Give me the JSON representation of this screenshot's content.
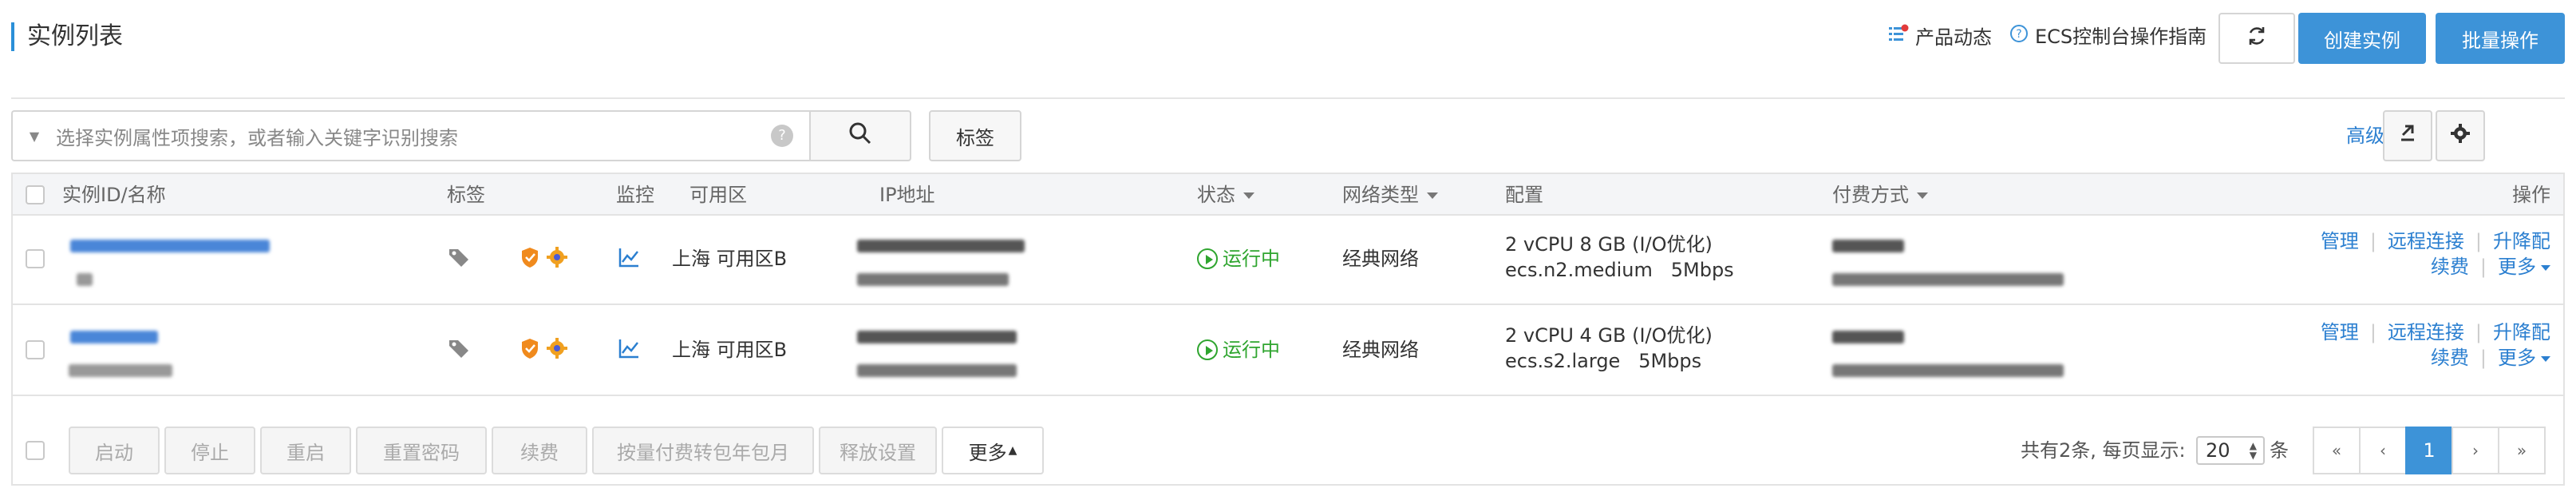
{
  "header": {
    "title": "实例列表",
    "news_label": "产品动态",
    "guide_label": "ECS控制台操作指南",
    "create_label": "创建实例",
    "batch_label": "批量操作"
  },
  "search": {
    "placeholder": "选择实例属性项搜索，或者输入关键字识别搜索",
    "tag_label": "标签",
    "advanced_label": "高级搜索"
  },
  "table": {
    "columns": {
      "id_name": "实例ID/名称",
      "tags": "标签",
      "monitor": "监控",
      "zone": "可用区",
      "ip": "IP地址",
      "status": "状态",
      "network": "网络类型",
      "config": "配置",
      "billing": "付费方式",
      "actions": "操作"
    },
    "rows": [
      {
        "zone": "上海 可用区B",
        "status": "运行中",
        "network": "经典网络",
        "config_line1": "2 vCPU 8 GB (I/O优化)",
        "config_line2": "ecs.n2.medium   5Mbps",
        "actions": {
          "manage": "管理",
          "remote": "远程连接",
          "upgrade": "升降配",
          "renew": "续费",
          "more": "更多"
        }
      },
      {
        "zone": "上海 可用区B",
        "status": "运行中",
        "network": "经典网络",
        "config_line1": "2 vCPU 4 GB (I/O优化)",
        "config_line2": "ecs.s2.large   5Mbps",
        "actions": {
          "manage": "管理",
          "remote": "远程连接",
          "upgrade": "升降配",
          "renew": "续费",
          "more": "更多"
        }
      }
    ]
  },
  "footer": {
    "buttons": [
      "启动",
      "停止",
      "重启",
      "重置密码",
      "续费",
      "按量付费转包年包月",
      "释放设置",
      "更多"
    ],
    "pagination_info": "共有2条, 每页显示:",
    "page_size": "20",
    "page_unit": "条",
    "pages": [
      "«",
      "‹",
      "1",
      "›",
      "»"
    ]
  },
  "colors": {
    "primary": "#3d93d8",
    "link": "#2b7fd0",
    "running": "#2fa52f"
  }
}
